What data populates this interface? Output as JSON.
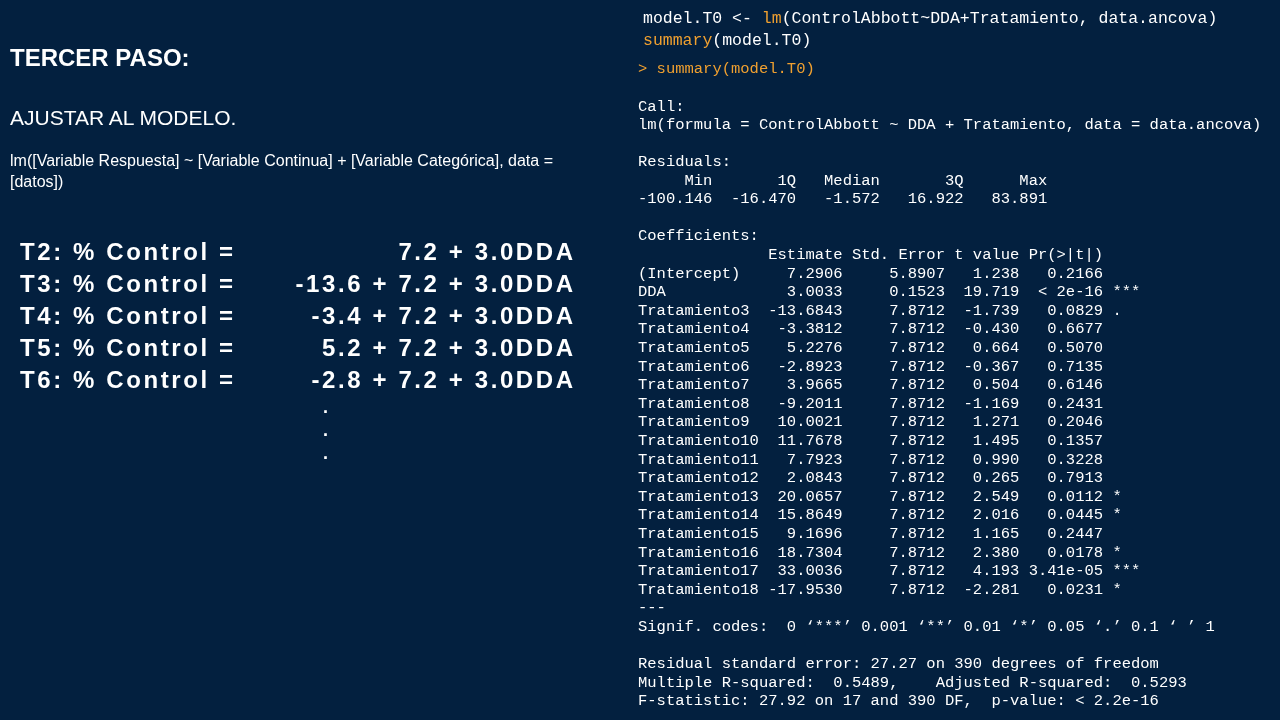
{
  "slide": {
    "title": "TERCER PASO:",
    "subtitle": "AJUSTAR AL MODELO.",
    "formula": "lm([Variable Respuesta] ~ [Variable Continua] + [Variable Categórica], data = [datos])",
    "equations": [
      {
        "label": "T2: % Control =",
        "value": "7.2 + 3.0DDA"
      },
      {
        "label": "T3: % Control =",
        "value": "-13.6 + 7.2 + 3.0DDA"
      },
      {
        "label": "T4: % Control =",
        "value": "-3.4 + 7.2 + 3.0DDA"
      },
      {
        "label": "T5: % Control =",
        "value": "5.2 + 7.2 + 3.0DDA"
      },
      {
        "label": "T6: % Control =",
        "value": "-2.8 + 7.2 + 3.0DDA"
      }
    ],
    "continuation": [
      ".",
      ".",
      "."
    ]
  },
  "console": {
    "script": [
      [
        {
          "kind": "plain",
          "text": "model.T0 <- "
        },
        {
          "kind": "fn",
          "text": "lm"
        },
        {
          "kind": "plain",
          "text": "(ControlAbbott~DDA+Tratamiento, data.ancova)"
        }
      ],
      [
        {
          "kind": "fn",
          "text": "summary"
        },
        {
          "kind": "plain",
          "text": "(model.T0)"
        }
      ]
    ],
    "echo": "> summary(model.T0)",
    "blocks": [
      [
        "Call:",
        "lm(formula = ControlAbbott ~ DDA + Tratamiento, data = data.ancova)"
      ],
      [
        "Residuals:",
        "     Min       1Q   Median       3Q      Max ",
        "-100.146  -16.470   -1.572   16.922   83.891 "
      ],
      [
        "Coefficients:",
        "              Estimate Std. Error t value Pr(>|t|)    ",
        "(Intercept)     7.2906     5.8907   1.238   0.2166    ",
        "DDA             3.0033     0.1523  19.719  < 2e-16 ***",
        "Tratamiento3  -13.6843     7.8712  -1.739   0.0829 .  ",
        "Tratamiento4   -3.3812     7.8712  -0.430   0.6677    ",
        "Tratamiento5    5.2276     7.8712   0.664   0.5070    ",
        "Tratamiento6   -2.8923     7.8712  -0.367   0.7135    ",
        "Tratamiento7    3.9665     7.8712   0.504   0.6146    ",
        "Tratamiento8   -9.2011     7.8712  -1.169   0.2431    ",
        "Tratamiento9   10.0021     7.8712   1.271   0.2046    ",
        "Tratamiento10  11.7678     7.8712   1.495   0.1357    ",
        "Tratamiento11   7.7923     7.8712   0.990   0.3228    ",
        "Tratamiento12   2.0843     7.8712   0.265   0.7913    ",
        "Tratamiento13  20.0657     7.8712   2.549   0.0112 *  ",
        "Tratamiento14  15.8649     7.8712   2.016   0.0445 *  ",
        "Tratamiento15   9.1696     7.8712   1.165   0.2447    ",
        "Tratamiento16  18.7304     7.8712   2.380   0.0178 *  ",
        "Tratamiento17  33.0036     7.8712   4.193 3.41e-05 ***",
        "Tratamiento18 -17.9530     7.8712  -2.281   0.0231 *  ",
        "---",
        "Signif. codes:  0 ‘***’ 0.001 ‘**’ 0.01 ‘*’ 0.05 ‘.’ 0.1 ‘ ’ 1"
      ],
      [
        "Residual standard error: 27.27 on 390 degrees of freedom",
        "Multiple R-squared:  0.5489,    Adjusted R-squared:  0.5293 ",
        "F-statistic: 27.92 on 17 and 390 DF,  p-value: < 2.2e-16"
      ]
    ]
  }
}
